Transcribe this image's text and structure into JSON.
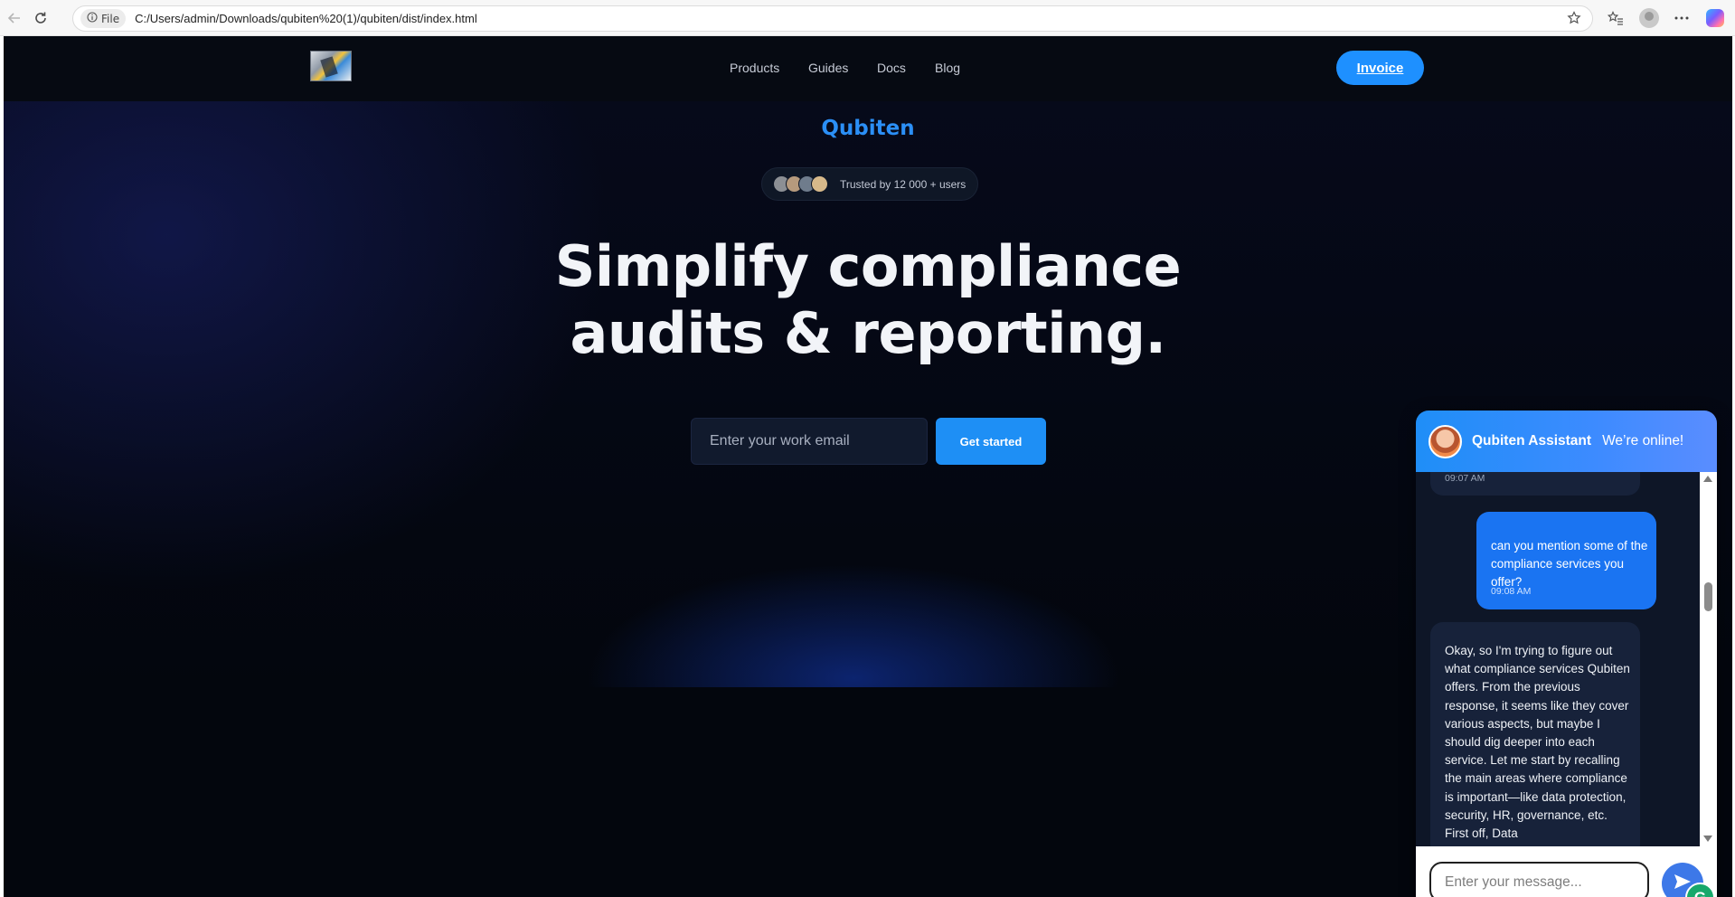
{
  "browser": {
    "file_label": "File",
    "url": "C:/Users/admin/Downloads/qubiten%20(1)/qubiten/dist/index.html"
  },
  "nav": {
    "links": [
      "Products",
      "Guides",
      "Docs",
      "Blog"
    ],
    "invoice_label": "Invoice"
  },
  "hero": {
    "brand": "Qubiten",
    "trust_text": "Trusted by 12 000 + users",
    "headline_line1": "Simplify compliance",
    "headline_line2": "audits & reporting.",
    "email_placeholder": "Enter your work email",
    "cta_label": "Get started"
  },
  "chat": {
    "assistant_name": "Qubiten Assistant",
    "status": "We’re online!",
    "messages": [
      {
        "from": "bot",
        "time": "09:07 AM"
      },
      {
        "from": "user",
        "text": "can you mention some of the compliance services you offer?",
        "time": "09:08 AM"
      },
      {
        "from": "bot",
        "text": "Okay, so I'm trying to figure out what compliance services Qubiten offers. From the previous response, it seems like they cover various aspects, but maybe I should dig deeper into each service. Let me start by recalling the main areas where compliance is important—like data protection, security, HR, governance, etc. First off, Data"
      }
    ],
    "input_placeholder": "Enter your message...",
    "grammarly_letter": "G"
  },
  "colors": {
    "page_bg": "#03060d",
    "brand_blue": "#2b8ff6",
    "cta_blue": "#1e8ff5",
    "user_bubble": "#1a74f2",
    "bot_bubble": "#17223a"
  },
  "icons": {
    "back": "back-arrow-icon",
    "reload": "reload-icon",
    "info": "info-icon",
    "favorite": "star-icon",
    "favorites_list": "favorites-icon",
    "profile": "profile-icon",
    "more": "more-icon",
    "copilot": "copilot-icon",
    "send": "send-icon"
  }
}
